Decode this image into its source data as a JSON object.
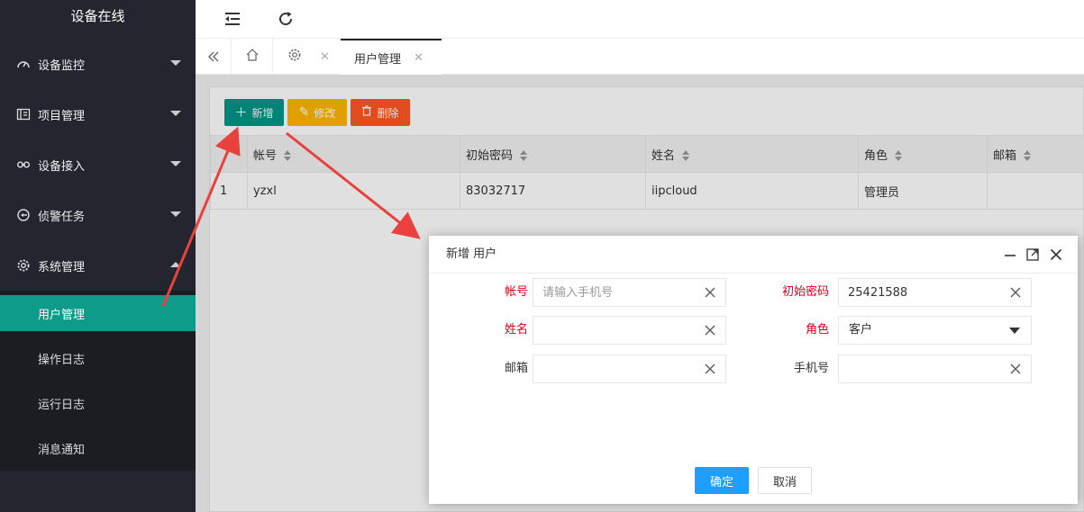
{
  "app": {
    "title": "设备在线"
  },
  "sidebar": {
    "items": [
      {
        "label": "设备监控",
        "icon": "dashboard-icon"
      },
      {
        "label": "项目管理",
        "icon": "project-icon"
      },
      {
        "label": "设备接入",
        "icon": "link-icon"
      },
      {
        "label": "侦警任务",
        "icon": "task-icon"
      },
      {
        "label": "系统管理",
        "icon": "gear-icon"
      }
    ],
    "subitems": [
      {
        "label": "用户管理",
        "active": true
      },
      {
        "label": "操作日志"
      },
      {
        "label": "运行日志"
      },
      {
        "label": "消息通知"
      }
    ]
  },
  "tabs": {
    "active_label": "用户管理"
  },
  "toolbar": {
    "add_label": "新增",
    "edit_label": "修改",
    "delete_label": "删除",
    "colors": {
      "add": "#009688",
      "edit": "#ffb800",
      "delete": "#ff5722"
    }
  },
  "table": {
    "columns": [
      "帐号",
      "初始密码",
      "姓名",
      "角色",
      "邮箱"
    ],
    "rows": [
      {
        "index": "1",
        "account": "yzxl",
        "password": "83032717",
        "name": "iipcloud",
        "role": "管理员",
        "email": ""
      }
    ]
  },
  "dialog": {
    "title": "新增 用户",
    "fields": {
      "account": {
        "label": "帐号",
        "placeholder": "请输入手机号",
        "value": ""
      },
      "password": {
        "label": "初始密码",
        "value": "25421588"
      },
      "name": {
        "label": "姓名",
        "value": ""
      },
      "role": {
        "label": "角色",
        "value": "客户"
      },
      "email": {
        "label": "邮箱",
        "value": ""
      },
      "phone": {
        "label": "手机号",
        "value": ""
      }
    },
    "confirm_label": "确定",
    "cancel_label": "取消",
    "colors": {
      "confirm": "#1e9fff",
      "required_label": "#d9001b"
    }
  }
}
